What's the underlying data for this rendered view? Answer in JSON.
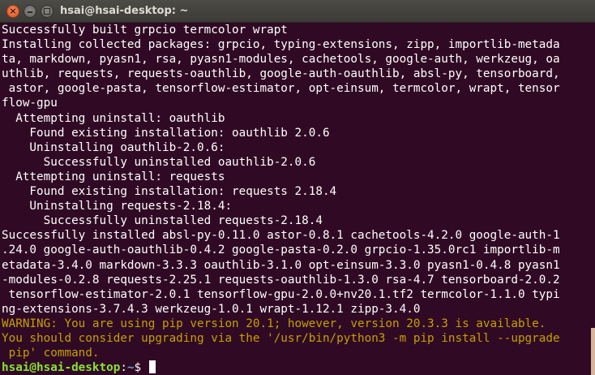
{
  "window": {
    "title": "hsai@hsai-desktop: ~",
    "close_symbol": "×"
  },
  "colors": {
    "background": "#300a24",
    "text": "#ffffff",
    "warning": "#c4a000",
    "prompt_user": "#8ae234",
    "prompt_path": "#729fcf"
  },
  "icons": {
    "close": "close-icon",
    "minimize": "minimize-icon",
    "maximize": "maximize-icon"
  },
  "terminal": {
    "output_lines": [
      "Successfully built grpcio termcolor wrapt",
      "Installing collected packages: grpcio, typing-extensions, zipp, importlib-metada",
      "ta, markdown, pyasn1, rsa, pyasn1-modules, cachetools, google-auth, werkzeug, oa",
      "uthlib, requests, requests-oauthlib, google-auth-oauthlib, absl-py, tensorboard,",
      " astor, google-pasta, tensorflow-estimator, opt-einsum, termcolor, wrapt, tensor",
      "flow-gpu",
      "  Attempting uninstall: oauthlib",
      "    Found existing installation: oauthlib 2.0.6",
      "    Uninstalling oauthlib-2.0.6:",
      "      Successfully uninstalled oauthlib-2.0.6",
      "  Attempting uninstall: requests",
      "    Found existing installation: requests 2.18.4",
      "    Uninstalling requests-2.18.4:",
      "      Successfully uninstalled requests-2.18.4",
      "Successfully installed absl-py-0.11.0 astor-0.8.1 cachetools-4.2.0 google-auth-1",
      ".24.0 google-auth-oauthlib-0.4.2 google-pasta-0.2.0 grpcio-1.35.0rc1 importlib-m",
      "etadata-3.4.0 markdown-3.3.3 oauthlib-3.1.0 opt-einsum-3.3.0 pyasn1-0.4.8 pyasn1",
      "-modules-0.2.8 requests-2.25.1 requests-oauthlib-1.3.0 rsa-4.7 tensorboard-2.0.2",
      " tensorflow-estimator-2.0.1 tensorflow-gpu-2.0.0+nv20.1.tf2 termcolor-1.1.0 typi",
      "ng-extensions-3.7.4.3 werkzeug-1.0.1 wrapt-1.12.1 zipp-3.4.0"
    ],
    "warning_lines": [
      "WARNING: You are using pip version 20.1; however, version 20.3.3 is available.",
      "You should consider upgrading via the '/usr/bin/python3 -m pip install --upgrade",
      " pip' command."
    ],
    "prompt": {
      "user_host": "hsai@hsai-desktop",
      "separator": ":",
      "path": "~",
      "symbol": "$ "
    }
  }
}
